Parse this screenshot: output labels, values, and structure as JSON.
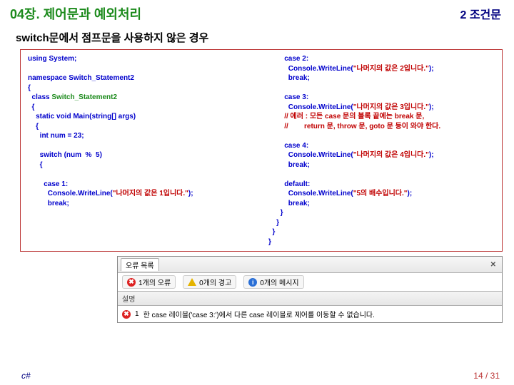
{
  "header": {
    "chapter": "04장. 제어문과 예외처리",
    "section": "2 조건문"
  },
  "subtitle": "switch문에서 점프문을 사용하지 않은 경우",
  "code": {
    "l1": "using System;",
    "l2": "namespace Switch_Statement2",
    "l3": "{",
    "l4a": "  class ",
    "l4b": "Switch_Statement2",
    "l5": "  {",
    "l6": "    static void Main(string[] args)",
    "l7": "    {",
    "l8": "      int num = 23;",
    "l9": "      switch (num  %  5)",
    "l10": "      {",
    "l11": "        case 1:",
    "l12a": "          Console.WriteLine(",
    "l12s": "\"나머지의 값은 1입니다.\"",
    "l12b": ");",
    "l13": "          break;",
    "r1": "        case 2:",
    "r2a": "          Console.WriteLine(",
    "r2s": "\"나머지의 값은 2입니다.\"",
    "r2b": ");",
    "r3": "          break;",
    "r4": "        case 3:",
    "r5a": "          Console.WriteLine(",
    "r5s": "\"나머지의 값은 3입니다.\"",
    "r5b": ");",
    "r6": "        // 에러 : 모든 case 문의 블록 끝에는 break 문,",
    "r7": "        //        return 문, throw 문, goto 문 등이 와야 한다.",
    "r8": "        case 4:",
    "r9a": "          Console.WriteLine(",
    "r9s": "\"나머지의 값은 4입니다.\"",
    "r9b": ");",
    "r10": "          break;",
    "r11": "        default:",
    "r12a": "          Console.WriteLine(",
    "r12s": "\"5의 배수입니다.\"",
    "r12b": ");",
    "r13": "          break;",
    "r14": "      }",
    "r15": "    }",
    "r16": "  }",
    "r17": "}"
  },
  "ide": {
    "tab_label": "오류 목록",
    "err_count": "1개의 오류",
    "warn_count": "0개의 경고",
    "msg_count": "0개의 메시지",
    "desc_header": "설명",
    "row_num": "1",
    "row_msg": "한 case 레이블('case 3:')에서 다른 case 레이블로 제어를 이동할 수 없습니다.",
    "close": "✕"
  },
  "footer": {
    "lang": "c#",
    "page": "14 / 31"
  }
}
